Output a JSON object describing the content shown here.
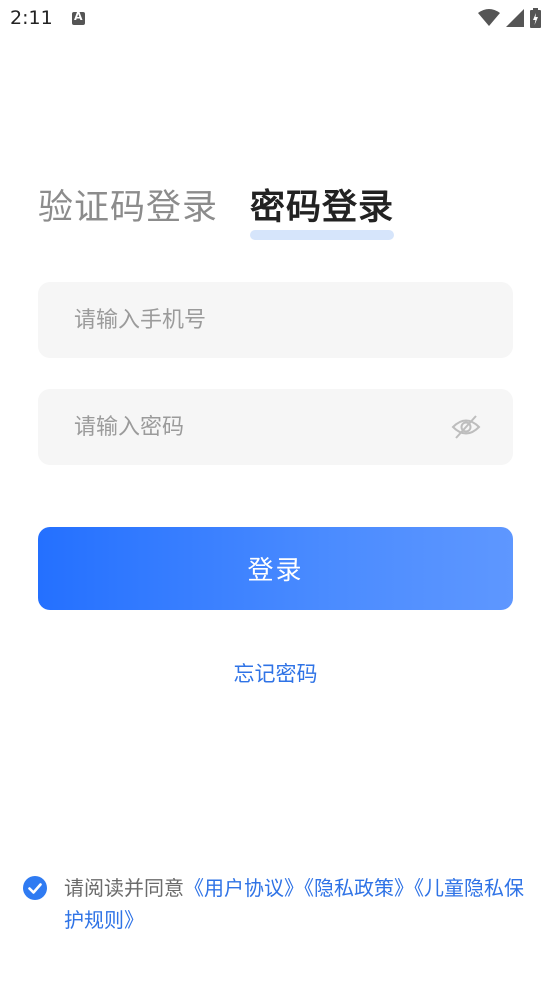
{
  "status_bar": {
    "time": "2:11",
    "icons": [
      "a-notification-icon",
      "wifi-icon",
      "signal-icon",
      "battery-charging-icon"
    ]
  },
  "tabs": {
    "sms_login": "验证码登录",
    "password_login": "密码登录",
    "active": "password_login"
  },
  "form": {
    "phone_placeholder": "请输入手机号",
    "phone_value": "",
    "password_placeholder": "请输入密码",
    "password_value": "",
    "password_toggle_icon": "eye-off-icon"
  },
  "login_button": "登录",
  "forgot_password": "忘记密码",
  "agreement": {
    "checked": true,
    "prefix": "请阅读并同意",
    "user_agreement": "《用户协议》",
    "privacy_policy": "《隐私政策》",
    "children_privacy": "《儿童隐私保护规则》"
  },
  "colors": {
    "accent": "#2f73e6",
    "button_gradient_start": "#2470ff",
    "button_gradient_end": "#5e97ff",
    "input_bg": "#f6f6f6",
    "tab_highlight": "#d6e5fb"
  }
}
